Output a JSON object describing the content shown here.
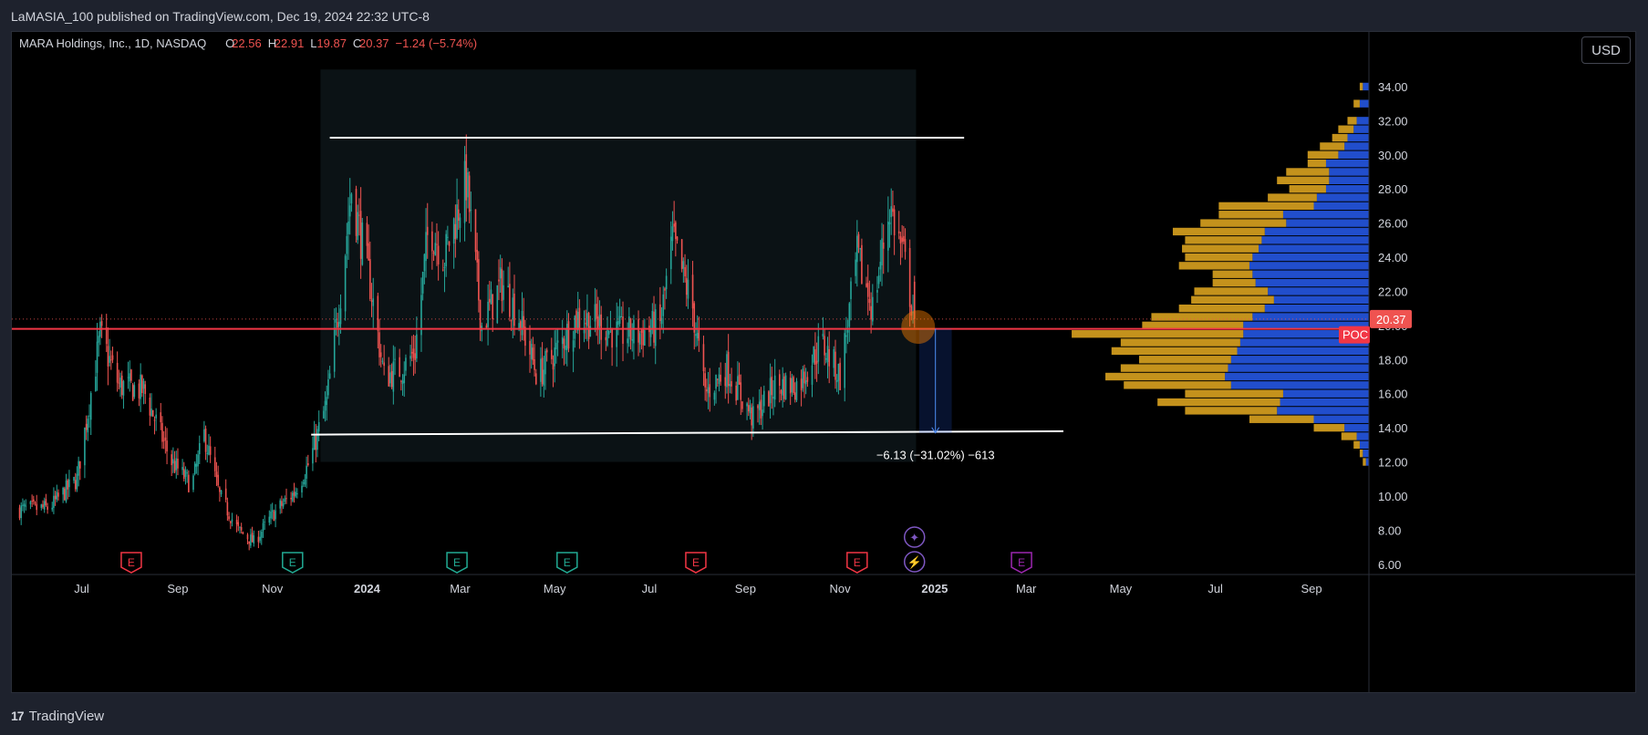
{
  "publisher_line": "LaMASIA_100 published on TradingView.com, Dec 19, 2024 22:32 UTC-8",
  "legend": {
    "symbol": "MARA Holdings, Inc., 1D, NASDAQ",
    "o_label": "O",
    "o_value": "22.56",
    "h_label": "H",
    "h_value": "22.91",
    "l_label": "L",
    "l_value": "19.87",
    "c_label": "C",
    "c_value": "20.37",
    "change": "−1.24 (−5.74%)"
  },
  "currency_button": "USD",
  "footer": {
    "logo_mark": "17",
    "brand": "TradingView"
  },
  "colors": {
    "up": "#26a69a",
    "down": "#ef5350",
    "background": "#000000",
    "panel": "#1e222d",
    "poc_line": "#f23645",
    "vp_up": "#2962ff",
    "vp_down": "#f5b623",
    "range_box": "#0b1215",
    "earnings_red": "#f23645",
    "earnings_teal": "#22ab94",
    "earnings_purple": "#9c27b0",
    "event_icon": "#7e57c2"
  },
  "chart_data": {
    "type": "candlestick",
    "symbol": "MARA",
    "interval": "1D",
    "exchange": "NASDAQ",
    "y_axis": {
      "ticks": [
        "6.00",
        "8.00",
        "10.00",
        "12.00",
        "14.00",
        "16.00",
        "18.00",
        "20.00",
        "22.00",
        "24.00",
        "26.00",
        "28.00",
        "30.00",
        "32.00",
        "34.00"
      ],
      "range": [
        5.4,
        35.6
      ],
      "last_price_label": "20.37",
      "poc_label": "POC",
      "poc_price": 19.8
    },
    "x_axis": {
      "ticks": [
        {
          "label": "Jul",
          "date": "2023-07-01",
          "bold": false
        },
        {
          "label": "Sep",
          "date": "2023-09-01",
          "bold": false
        },
        {
          "label": "Nov",
          "date": "2023-11-01",
          "bold": false
        },
        {
          "label": "2024",
          "date": "2024-01-01",
          "bold": true
        },
        {
          "label": "Mar",
          "date": "2024-03-01",
          "bold": false
        },
        {
          "label": "May",
          "date": "2024-05-01",
          "bold": false
        },
        {
          "label": "Jul",
          "date": "2024-07-01",
          "bold": false
        },
        {
          "label": "Sep",
          "date": "2024-09-01",
          "bold": false
        },
        {
          "label": "Nov",
          "date": "2024-11-01",
          "bold": false
        },
        {
          "label": "2025",
          "date": "2025-01-01",
          "bold": true
        },
        {
          "label": "Mar",
          "date": "2025-03-01",
          "bold": false
        },
        {
          "label": "May",
          "date": "2025-05-01",
          "bold": false
        },
        {
          "label": "Jul",
          "date": "2025-07-01",
          "bold": false
        },
        {
          "label": "Sep",
          "date": "2025-09-01",
          "bold": false
        }
      ]
    },
    "price_path": [
      {
        "date": "2023-05-20",
        "close": 9.2
      },
      {
        "date": "2023-06-10",
        "close": 9.3
      },
      {
        "date": "2023-06-28",
        "close": 11.0
      },
      {
        "date": "2023-07-13",
        "close": 19.4
      },
      {
        "date": "2023-07-25",
        "close": 16.5
      },
      {
        "date": "2023-08-10",
        "close": 16.2
      },
      {
        "date": "2023-08-28",
        "close": 12.0
      },
      {
        "date": "2023-09-10",
        "close": 10.6
      },
      {
        "date": "2023-09-18",
        "close": 13.6
      },
      {
        "date": "2023-09-28",
        "close": 10.0
      },
      {
        "date": "2023-10-10",
        "close": 8.0
      },
      {
        "date": "2023-10-20",
        "close": 7.3
      },
      {
        "date": "2023-11-02",
        "close": 9.0
      },
      {
        "date": "2023-11-15",
        "close": 10.2
      },
      {
        "date": "2023-11-25",
        "close": 12.0
      },
      {
        "date": "2023-12-06",
        "close": 15.5
      },
      {
        "date": "2023-12-15",
        "close": 22.0
      },
      {
        "date": "2023-12-22",
        "close": 28.0
      },
      {
        "date": "2024-01-03",
        "close": 22.5
      },
      {
        "date": "2024-01-12",
        "close": 17.0
      },
      {
        "date": "2024-01-24",
        "close": 17.5
      },
      {
        "date": "2024-02-01",
        "close": 18.5
      },
      {
        "date": "2024-02-10",
        "close": 26.0
      },
      {
        "date": "2024-02-20",
        "close": 24.0
      },
      {
        "date": "2024-03-05",
        "close": 28.5
      },
      {
        "date": "2024-03-15",
        "close": 20.0
      },
      {
        "date": "2024-03-28",
        "close": 22.5
      },
      {
        "date": "2024-04-08",
        "close": 20.5
      },
      {
        "date": "2024-04-20",
        "close": 17.0
      },
      {
        "date": "2024-05-02",
        "close": 18.5
      },
      {
        "date": "2024-05-15",
        "close": 20.5
      },
      {
        "date": "2024-05-28",
        "close": 20.2
      },
      {
        "date": "2024-06-10",
        "close": 19.5
      },
      {
        "date": "2024-06-24",
        "close": 19.5
      },
      {
        "date": "2024-07-08",
        "close": 20.0
      },
      {
        "date": "2024-07-16",
        "close": 25.0
      },
      {
        "date": "2024-07-29",
        "close": 21.0
      },
      {
        "date": "2024-08-06",
        "close": 16.0
      },
      {
        "date": "2024-08-20",
        "close": 17.5
      },
      {
        "date": "2024-09-06",
        "close": 14.5
      },
      {
        "date": "2024-09-20",
        "close": 16.5
      },
      {
        "date": "2024-10-05",
        "close": 16.5
      },
      {
        "date": "2024-10-20",
        "close": 19.0
      },
      {
        "date": "2024-11-01",
        "close": 17.0
      },
      {
        "date": "2024-11-12",
        "close": 24.0
      },
      {
        "date": "2024-11-22",
        "close": 21.0
      },
      {
        "date": "2024-12-03",
        "close": 27.0
      },
      {
        "date": "2024-12-12",
        "close": 24.0
      },
      {
        "date": "2024-12-19",
        "close": 20.37
      }
    ],
    "last_bar": {
      "date": "2024-12-19",
      "open": 22.56,
      "high": 22.91,
      "low": 19.87,
      "close": 20.37,
      "change": -1.24,
      "change_pct": -5.74
    },
    "trendlines": [
      {
        "name": "range-top",
        "from": {
          "date": "2023-12-08",
          "price": 31.0
        },
        "to": {
          "date": "2025-01-20",
          "price": 31.0
        }
      },
      {
        "name": "range-bottom",
        "from": {
          "date": "2023-11-26",
          "price": 13.6
        },
        "to": {
          "date": "2025-03-25",
          "price": 13.8
        }
      }
    ],
    "range_box": {
      "from_date": "2023-12-02",
      "to_date": "2024-12-20",
      "top": 35.0,
      "bottom": 12.0
    },
    "measure": {
      "from_date": "2024-12-22",
      "to_date": "2025-01-12",
      "from_price": 19.8,
      "to_price": 13.7,
      "label": "−6.13 (−31.02%) −613"
    },
    "poc_marker": {
      "date": "2024-12-19",
      "price": 19.8
    },
    "volume_profile": {
      "rows": [
        {
          "price": 34.0,
          "up": 0.02,
          "down": 0.01
        },
        {
          "price": 33.0,
          "up": 0.03,
          "down": 0.02
        },
        {
          "price": 32.0,
          "up": 0.04,
          "down": 0.03
        },
        {
          "price": 31.5,
          "up": 0.05,
          "down": 0.05
        },
        {
          "price": 31.0,
          "up": 0.07,
          "down": 0.05
        },
        {
          "price": 30.5,
          "up": 0.08,
          "down": 0.08
        },
        {
          "price": 30.0,
          "up": 0.1,
          "down": 0.1
        },
        {
          "price": 29.5,
          "up": 0.14,
          "down": 0.06
        },
        {
          "price": 29.0,
          "up": 0.13,
          "down": 0.14
        },
        {
          "price": 28.5,
          "up": 0.13,
          "down": 0.17
        },
        {
          "price": 28.0,
          "up": 0.14,
          "down": 0.12
        },
        {
          "price": 27.5,
          "up": 0.17,
          "down": 0.16
        },
        {
          "price": 27.0,
          "up": 0.18,
          "down": 0.31
        },
        {
          "price": 26.5,
          "up": 0.28,
          "down": 0.21
        },
        {
          "price": 26.0,
          "up": 0.27,
          "down": 0.28
        },
        {
          "price": 25.5,
          "up": 0.34,
          "down": 0.3
        },
        {
          "price": 25.0,
          "up": 0.35,
          "down": 0.25
        },
        {
          "price": 24.5,
          "up": 0.36,
          "down": 0.25
        },
        {
          "price": 24.0,
          "up": 0.38,
          "down": 0.22
        },
        {
          "price": 23.5,
          "up": 0.39,
          "down": 0.23
        },
        {
          "price": 23.0,
          "up": 0.38,
          "down": 0.13
        },
        {
          "price": 22.5,
          "up": 0.37,
          "down": 0.14
        },
        {
          "price": 22.0,
          "up": 0.33,
          "down": 0.24
        },
        {
          "price": 21.5,
          "up": 0.31,
          "down": 0.27
        },
        {
          "price": 21.0,
          "up": 0.34,
          "down": 0.28
        },
        {
          "price": 20.5,
          "up": 0.38,
          "down": 0.33
        },
        {
          "price": 20.0,
          "up": 0.41,
          "down": 0.33
        },
        {
          "price": 19.5,
          "up": 0.41,
          "down": 0.56
        },
        {
          "price": 19.0,
          "up": 0.42,
          "down": 0.39
        },
        {
          "price": 18.5,
          "up": 0.43,
          "down": 0.41
        },
        {
          "price": 18.0,
          "up": 0.45,
          "down": 0.3
        },
        {
          "price": 17.5,
          "up": 0.46,
          "down": 0.35
        },
        {
          "price": 17.0,
          "up": 0.47,
          "down": 0.39
        },
        {
          "price": 16.5,
          "up": 0.45,
          "down": 0.35
        },
        {
          "price": 16.0,
          "up": 0.28,
          "down": 0.32
        },
        {
          "price": 15.5,
          "up": 0.29,
          "down": 0.4
        },
        {
          "price": 15.0,
          "up": 0.3,
          "down": 0.3
        },
        {
          "price": 14.5,
          "up": 0.18,
          "down": 0.21
        },
        {
          "price": 14.0,
          "up": 0.08,
          "down": 0.1
        },
        {
          "price": 13.5,
          "up": 0.04,
          "down": 0.05
        },
        {
          "price": 13.0,
          "up": 0.03,
          "down": 0.02
        },
        {
          "price": 12.5,
          "up": 0.02,
          "down": 0.01
        },
        {
          "price": 12.0,
          "up": 0.01,
          "down": 0.01
        }
      ]
    },
    "events": [
      {
        "kind": "earnings",
        "label": "E",
        "date": "2023-08-02",
        "color": "red"
      },
      {
        "kind": "earnings",
        "label": "E",
        "date": "2023-11-14",
        "color": "teal"
      },
      {
        "kind": "earnings",
        "label": "E",
        "date": "2024-02-28",
        "color": "teal"
      },
      {
        "kind": "earnings",
        "label": "E",
        "date": "2024-05-09",
        "color": "teal"
      },
      {
        "kind": "earnings",
        "label": "E",
        "date": "2024-07-31",
        "color": "red"
      },
      {
        "kind": "earnings",
        "label": "E",
        "date": "2024-11-12",
        "color": "red"
      },
      {
        "kind": "earnings",
        "label": "E",
        "date": "2025-02-26",
        "color": "purple"
      },
      {
        "kind": "news",
        "label": "✦",
        "date": "2024-12-19",
        "row": "upper"
      },
      {
        "kind": "dividend",
        "label": "⚡",
        "date": "2024-12-19",
        "row": "lower"
      }
    ]
  }
}
